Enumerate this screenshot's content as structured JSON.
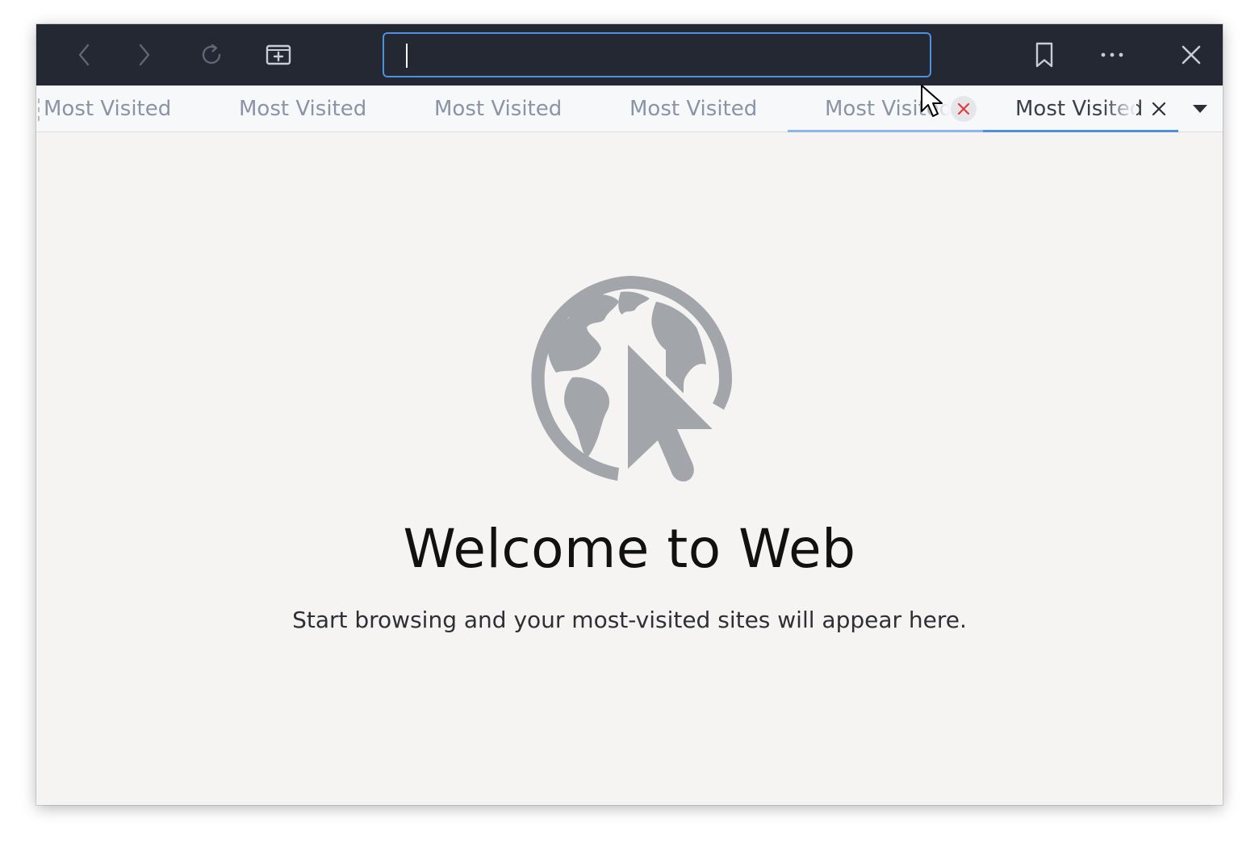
{
  "header": {
    "back_icon": "chevron-left-icon",
    "forward_icon": "chevron-right-icon",
    "reload_icon": "reload-icon",
    "new_tab_icon": "new-tab-icon",
    "url": {
      "value": "",
      "placeholder": ""
    },
    "bookmark_icon": "bookmark-icon",
    "menu_icon": "more-horizontal-icon",
    "close_icon": "close-icon"
  },
  "tabs": [
    {
      "label": "Most Visited",
      "active": false
    },
    {
      "label": "Most Visited",
      "active": false
    },
    {
      "label": "Most Visited",
      "active": false
    },
    {
      "label": "Most Visited",
      "active": false
    },
    {
      "label": "Most Visited",
      "active": false,
      "close_hovered": true
    },
    {
      "label": "Most Visited",
      "active": true
    }
  ],
  "tab_overflow_icon": "dropdown-arrow-icon",
  "content": {
    "icon": "globe-pointer-icon",
    "title": "Welcome to Web",
    "subtitle": "Start browsing and your most-visited sites will appear here."
  },
  "colors": {
    "headerbar": "#232833",
    "accent": "#4f8fe0",
    "tab_hover_underline": "#8fb4ec",
    "close_hover_red": "#e0393e",
    "content_bg": "#f5f4f3",
    "icon_gray": "#a2a6ab"
  }
}
